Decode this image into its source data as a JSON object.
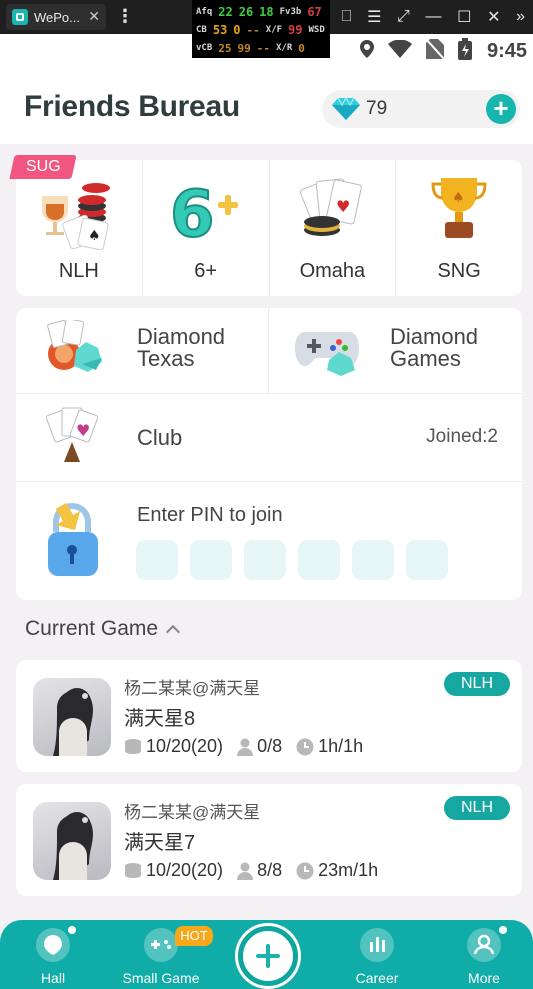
{
  "window": {
    "tab_title": "WePo...",
    "tab_close": "✕",
    "menu": "⋮",
    "controls": [
      "⎕",
      "☰",
      "⤢",
      "—",
      "☐",
      "✕",
      "»"
    ]
  },
  "overlay": {
    "row1": {
      "l1": "Afq",
      "v1": "22",
      "v2": "26",
      "v3": "18",
      "l2": "Fv3b",
      "v4": "67"
    },
    "row2": {
      "l1": "CB",
      "v1": "53",
      "v2": "0",
      "v3": "--",
      "l2": "X/F",
      "v4": "99",
      "l3": "WSD"
    },
    "row3": {
      "l1": "vCB",
      "v1": "25",
      "v2": "99",
      "v3": "--",
      "l2": "X/R",
      "v4": "0"
    }
  },
  "status": {
    "time": "9:45"
  },
  "header": {
    "title": "Friends Bureau",
    "diamonds": "79",
    "add_symbol": "+"
  },
  "modes": {
    "badge": "SUG",
    "items": [
      {
        "label": "NLH"
      },
      {
        "label": "6+"
      },
      {
        "label": "Omaha"
      },
      {
        "label": "SNG"
      }
    ]
  },
  "features": {
    "diamond_texas": {
      "line1": "Diamond",
      "line2": "Texas"
    },
    "diamond_games": {
      "line1": "Diamond",
      "line2": "Games"
    },
    "club": {
      "label": "Club",
      "joined": "Joined:2"
    },
    "pin": {
      "label": "Enter PIN to join",
      "box_count": 6
    }
  },
  "current_game": {
    "title": "Current Game",
    "games": [
      {
        "host": "杨二某某@满天星",
        "name": "满天星8",
        "blinds": "10/20(20)",
        "players": "0/8",
        "time": "1h/1h",
        "tag": "NLH"
      },
      {
        "host": "杨二某某@满天星",
        "name": "满天星7",
        "blinds": "10/20(20)",
        "players": "8/8",
        "time": "23m/1h",
        "tag": "NLH"
      }
    ]
  },
  "nav": {
    "items": [
      {
        "label": "Hall",
        "icon": "hall-icon"
      },
      {
        "label": "Small Game",
        "icon": "gamepad-icon"
      },
      {
        "label": "Career",
        "icon": "chart-icon"
      },
      {
        "label": "More",
        "icon": "user-icon"
      }
    ],
    "hot_badge": "HOT"
  },
  "colors": {
    "teal": "#10aca7",
    "badge_pink": "#f0567f",
    "hot_orange": "#f6a71a"
  }
}
